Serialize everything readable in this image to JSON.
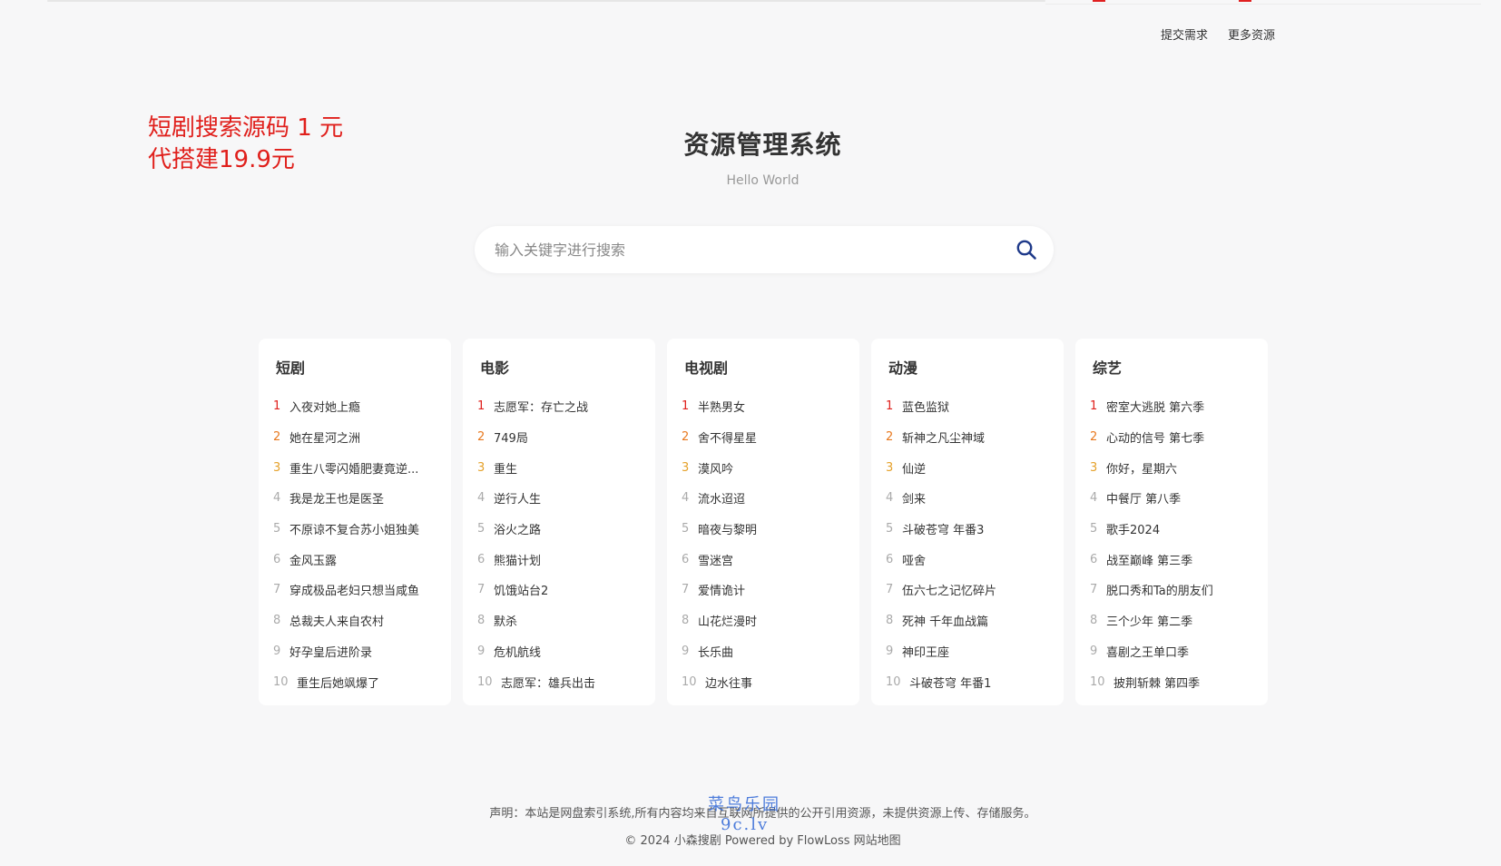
{
  "topnav": {
    "submit": "提交需求",
    "more": "更多资源"
  },
  "promo": {
    "line1": "短剧搜索源码 1 元",
    "line2": "代搭建19.9元"
  },
  "header": {
    "title": "资源管理系统",
    "subtitle": "Hello World"
  },
  "search": {
    "placeholder": "输入关键字进行搜索",
    "value": ""
  },
  "icons": {
    "search": "search-icon"
  },
  "colors": {
    "rank1": "#e0201c",
    "rank2": "#e8791f",
    "rank3": "#e5a12a",
    "promo": "#e0201c",
    "searchIcon": "#1f3a8a"
  },
  "categories": [
    {
      "title": "短剧",
      "items": [
        {
          "rank": "1",
          "title": "入夜对她上瘾"
        },
        {
          "rank": "2",
          "title": "她在星河之洲"
        },
        {
          "rank": "3",
          "title": "重生八零闪婚肥妻竟逆..."
        },
        {
          "rank": "4",
          "title": "我是龙王也是医圣"
        },
        {
          "rank": "5",
          "title": "不原谅不复合苏小姐独美"
        },
        {
          "rank": "6",
          "title": "金风玉露"
        },
        {
          "rank": "7",
          "title": "穿成极品老妇只想当咸鱼"
        },
        {
          "rank": "8",
          "title": "总裁夫人来自农村"
        },
        {
          "rank": "9",
          "title": "好孕皇后进阶录"
        },
        {
          "rank": "10",
          "title": "重生后她飒爆了"
        }
      ]
    },
    {
      "title": "电影",
      "items": [
        {
          "rank": "1",
          "title": "志愿军：存亡之战"
        },
        {
          "rank": "2",
          "title": "749局"
        },
        {
          "rank": "3",
          "title": "重生"
        },
        {
          "rank": "4",
          "title": "逆行人生"
        },
        {
          "rank": "5",
          "title": "浴火之路"
        },
        {
          "rank": "6",
          "title": "熊猫计划"
        },
        {
          "rank": "7",
          "title": "饥饿站台2"
        },
        {
          "rank": "8",
          "title": "默杀"
        },
        {
          "rank": "9",
          "title": "危机航线"
        },
        {
          "rank": "10",
          "title": "志愿军：雄兵出击"
        }
      ]
    },
    {
      "title": "电视剧",
      "items": [
        {
          "rank": "1",
          "title": "半熟男女"
        },
        {
          "rank": "2",
          "title": "舍不得星星"
        },
        {
          "rank": "3",
          "title": "漠风吟"
        },
        {
          "rank": "4",
          "title": "流水迢迢"
        },
        {
          "rank": "5",
          "title": "暗夜与黎明"
        },
        {
          "rank": "6",
          "title": "雪迷宫"
        },
        {
          "rank": "7",
          "title": "爱情诡计"
        },
        {
          "rank": "8",
          "title": "山花烂漫时"
        },
        {
          "rank": "9",
          "title": "长乐曲"
        },
        {
          "rank": "10",
          "title": "边水往事"
        }
      ]
    },
    {
      "title": "动漫",
      "items": [
        {
          "rank": "1",
          "title": "蓝色监狱"
        },
        {
          "rank": "2",
          "title": "斩神之凡尘神域"
        },
        {
          "rank": "3",
          "title": "仙逆"
        },
        {
          "rank": "4",
          "title": "剑来"
        },
        {
          "rank": "5",
          "title": "斗破苍穹 年番3"
        },
        {
          "rank": "6",
          "title": "哑舍"
        },
        {
          "rank": "7",
          "title": "伍六七之记忆碎片"
        },
        {
          "rank": "8",
          "title": "死神 千年血战篇"
        },
        {
          "rank": "9",
          "title": "神印王座"
        },
        {
          "rank": "10",
          "title": "斗破苍穹 年番1"
        }
      ]
    },
    {
      "title": "综艺",
      "items": [
        {
          "rank": "1",
          "title": "密室大逃脱 第六季"
        },
        {
          "rank": "2",
          "title": "心动的信号 第七季"
        },
        {
          "rank": "3",
          "title": "你好，星期六"
        },
        {
          "rank": "4",
          "title": "中餐厅 第八季"
        },
        {
          "rank": "5",
          "title": "歌手2024"
        },
        {
          "rank": "6",
          "title": "战至巅峰 第三季"
        },
        {
          "rank": "7",
          "title": "脱口秀和Ta的朋友们"
        },
        {
          "rank": "8",
          "title": "三个少年 第二季"
        },
        {
          "rank": "9",
          "title": "喜剧之王单口季"
        },
        {
          "rank": "10",
          "title": "披荆斩棘 第四季"
        }
      ]
    }
  ],
  "footer": {
    "disclaimer": "声明：本站是网盘索引系统,所有内容均来自互联网所提供的公开引用资源，未提供资源上传、存储服务。",
    "copyright": "© 2024 小森搜剧 Powered by FlowLoss",
    "sitemap": "网站地图"
  },
  "watermark": {
    "line1": "菜鸟乐园",
    "line2": "9c.lv"
  }
}
